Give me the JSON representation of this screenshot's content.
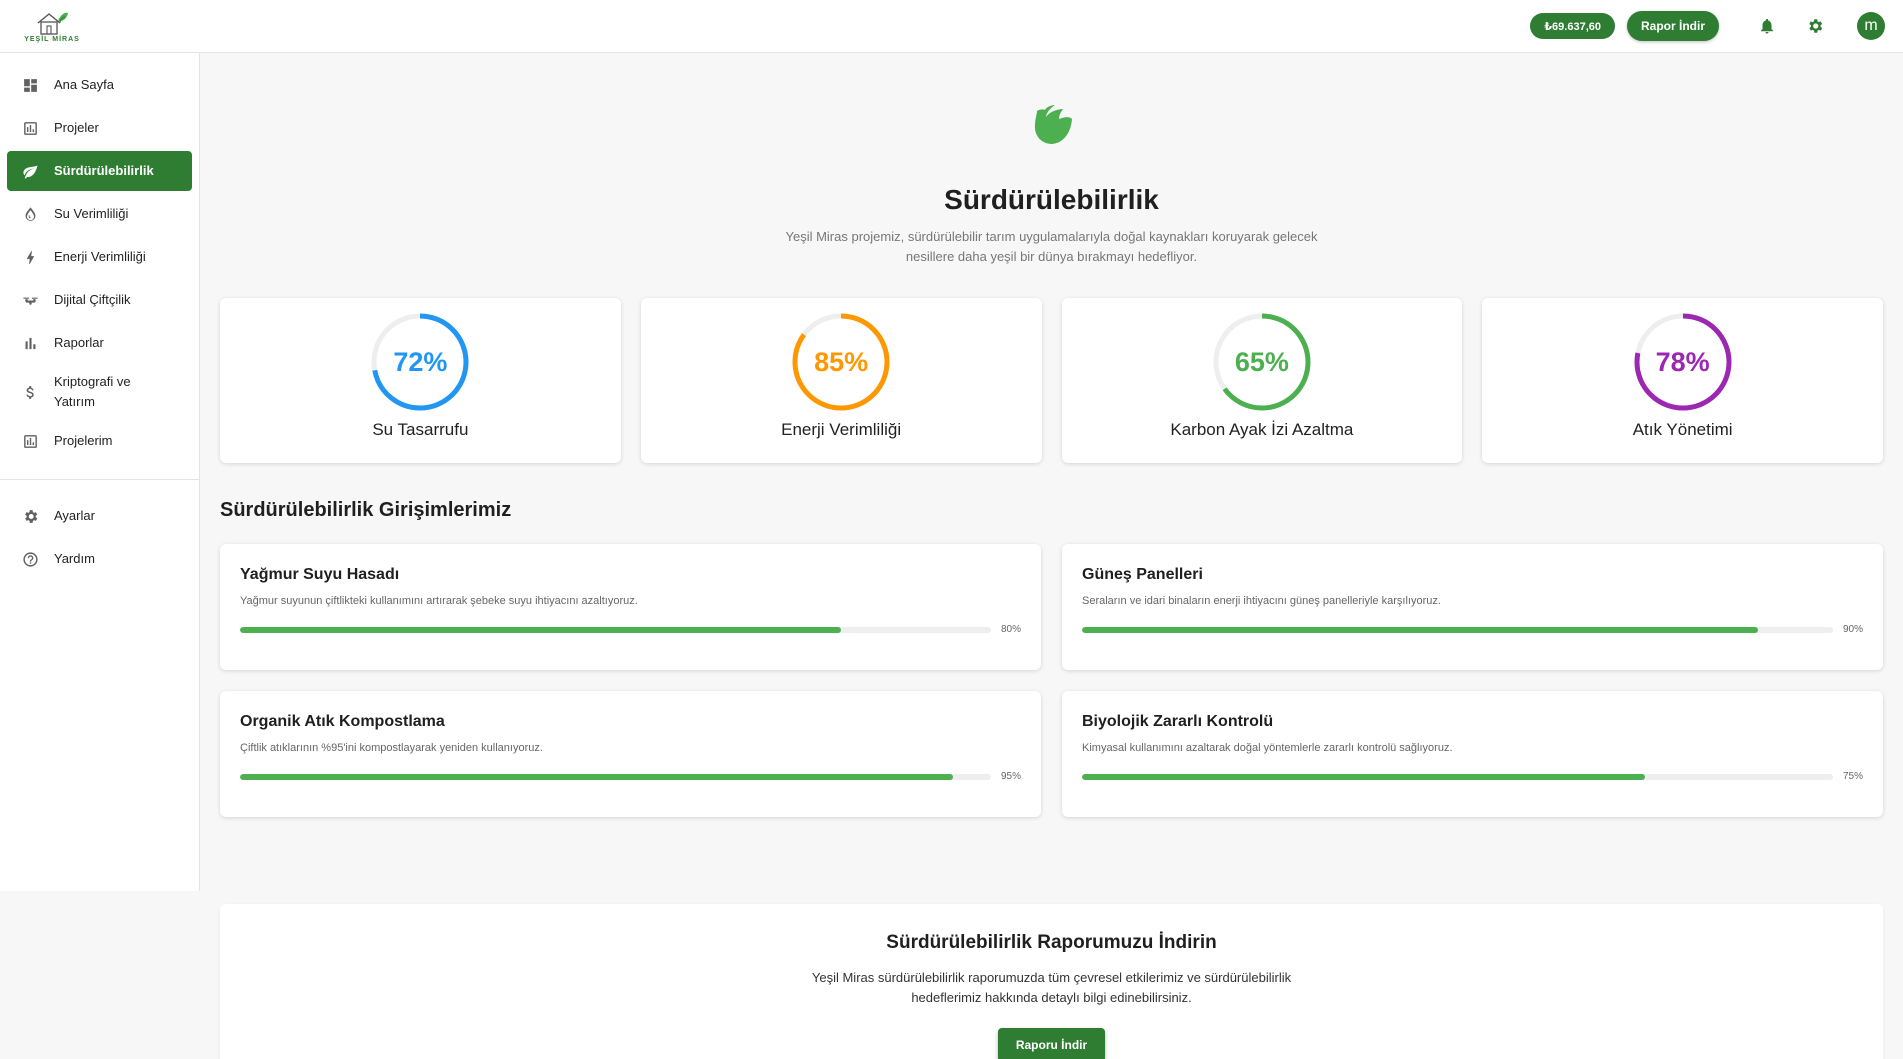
{
  "brand": {
    "logo_text": "YEŞİL MİRAS"
  },
  "header": {
    "balance": "₺69.637,60",
    "report_button": "Rapor İndir",
    "avatar_letter": "m"
  },
  "sidebar": {
    "items": [
      {
        "label": "Ana Sayfa",
        "icon": "dashboard-icon"
      },
      {
        "label": "Projeler",
        "icon": "bar-chart-box-icon"
      },
      {
        "label": "Sürdürülebilirlik",
        "icon": "leaf-icon",
        "active": true
      },
      {
        "label": "Su Verimliliği",
        "icon": "water-drop-icon"
      },
      {
        "label": "Enerji Verimliliği",
        "icon": "bolt-icon"
      },
      {
        "label": "Dijital Çiftçilik",
        "icon": "drone-icon"
      },
      {
        "label": "Raporlar",
        "icon": "bar-chart-icon"
      },
      {
        "label": "Kriptografi ve Yatırım",
        "icon": "dollar-icon"
      },
      {
        "label": "Projelerim",
        "icon": "bar-chart-box-icon"
      }
    ],
    "bottom_items": [
      {
        "label": "Ayarlar",
        "icon": "gear-icon"
      },
      {
        "label": "Yardım",
        "icon": "help-circle-icon"
      }
    ]
  },
  "hero": {
    "title": "Sürdürülebilirlik",
    "description": "Yeşil Miras projemiz, sürdürülebilir tarım uygulamalarıyla doğal kaynakları koruyarak gelecek nesillere daha yeşil bir dünya bırakmayı hedefliyor."
  },
  "metrics": [
    {
      "label": "Su Tasarrufu",
      "value_text": "72%",
      "value": 72,
      "color": "#2196f3"
    },
    {
      "label": "Enerji Verimliliği",
      "value_text": "85%",
      "value": 85,
      "color": "#ff9800"
    },
    {
      "label": "Karbon Ayak İzi Azaltma",
      "value_text": "65%",
      "value": 65,
      "color": "#4caf50"
    },
    {
      "label": "Atık Yönetimi",
      "value_text": "78%",
      "value": 78,
      "color": "#9c27b0"
    }
  ],
  "initiatives_title": "Sürdürülebilirlik Girişimlerimiz",
  "initiatives": [
    {
      "title": "Yağmur Suyu Hasadı",
      "desc": "Yağmur suyunun çiftlikteki kullanımını artırarak şebeke suyu ihtiyacını azaltıyoruz.",
      "pct_text": "80%",
      "pct": 80
    },
    {
      "title": "Güneş Panelleri",
      "desc": "Seraların ve idari binaların enerji ihtiyacını güneş panelleriyle karşılıyoruz.",
      "pct_text": "90%",
      "pct": 90
    },
    {
      "title": "Organik Atık Kompostlama",
      "desc": "Çiftlik atıklarının %95'ini kompostlayarak yeniden kullanıyoruz.",
      "pct_text": "95%",
      "pct": 95
    },
    {
      "title": "Biyolojik Zararlı Kontrolü",
      "desc": "Kimyasal kullanımını azaltarak doğal yöntemlerle zararlı kontrolü sağlıyoruz.",
      "pct_text": "75%",
      "pct": 75
    }
  ],
  "download": {
    "title": "Sürdürülebilirlik Raporumuzu İndirin",
    "description": "Yeşil Miras sürdürülebilirlik raporumuzda tüm çevresel etkilerimiz ve sürdürülebilirlik hedeflerimiz hakkında detaylı bilgi edinebilirsiniz.",
    "button": "Raporu İndir"
  },
  "colors": {
    "primary": "#2e7d32",
    "accent_green": "#4caf50"
  }
}
